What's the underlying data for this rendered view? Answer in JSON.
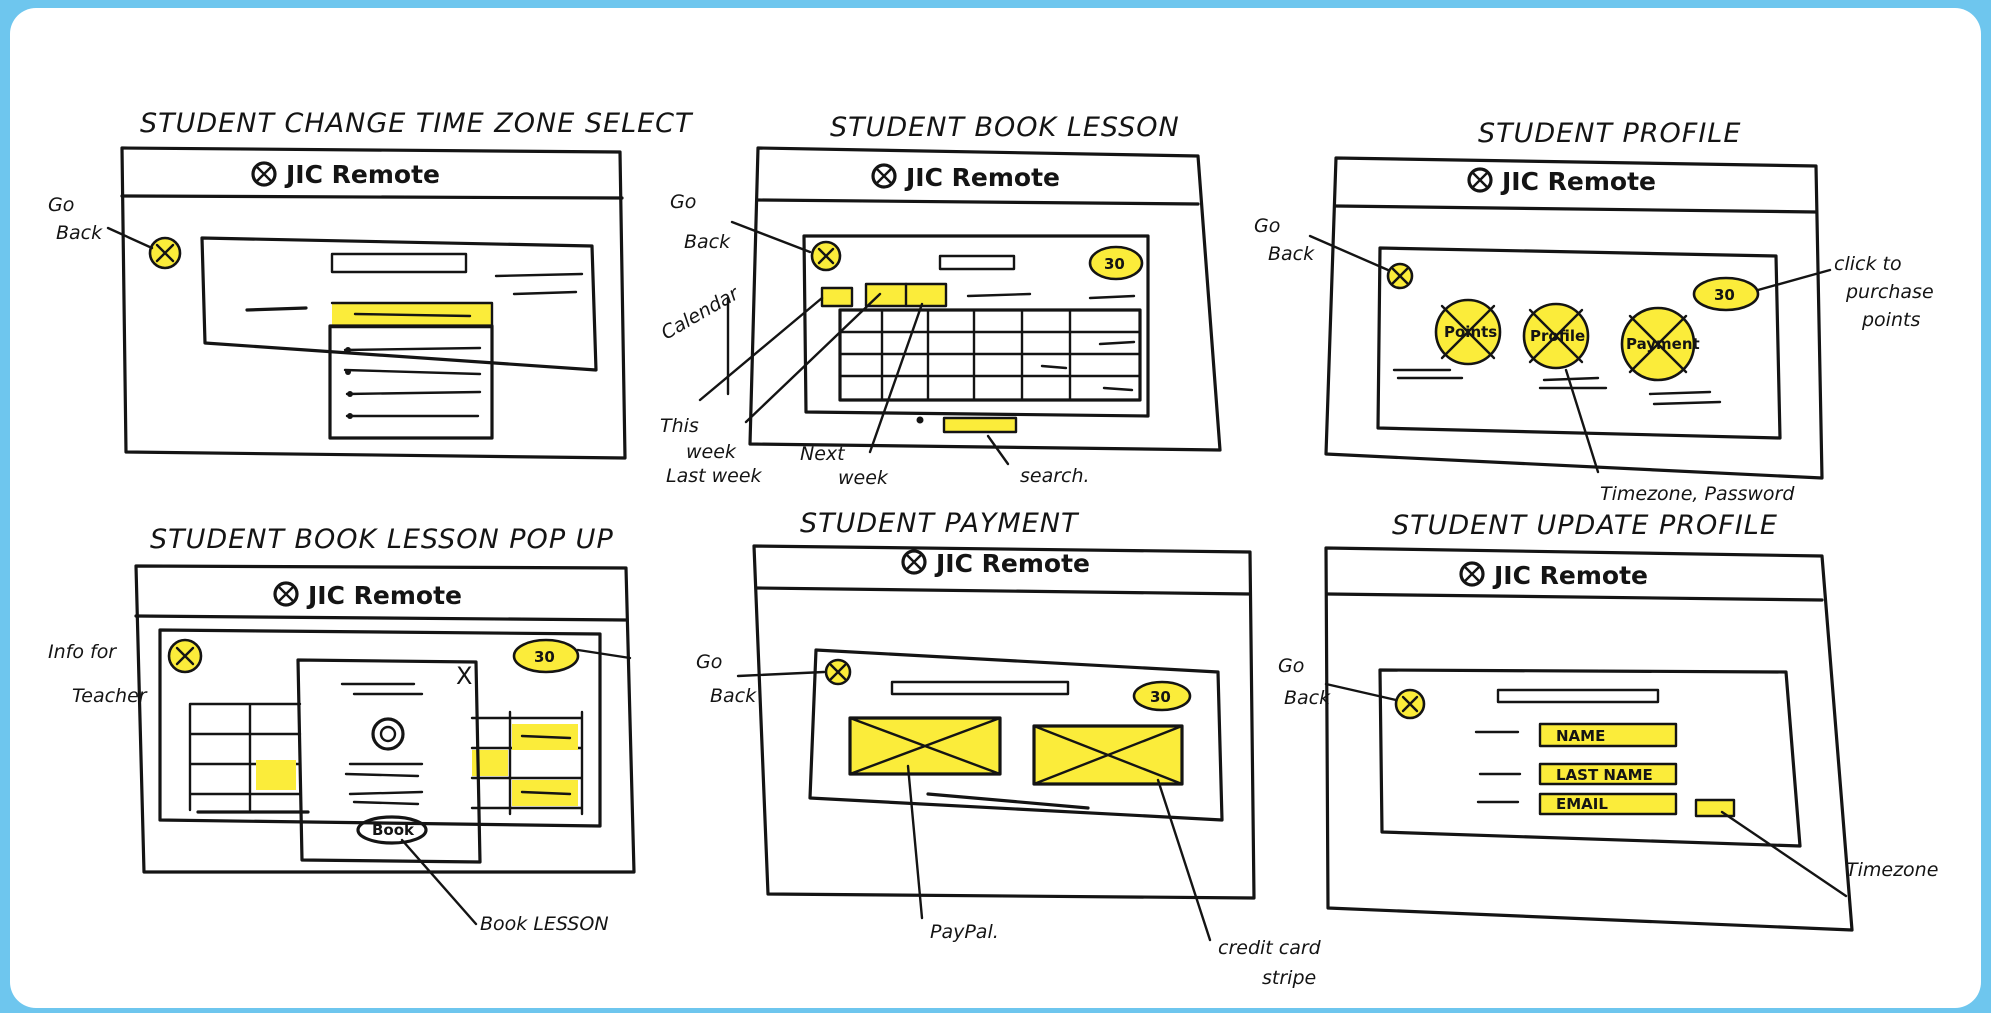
{
  "frames": [
    {
      "title": "STUDENT CHANGE TIME ZONE SELECT",
      "app_name": "JIC Remote",
      "notes": [
        "Go",
        "Back"
      ]
    },
    {
      "title": "STUDENT BOOK LESSON",
      "app_name": "JIC Remote",
      "points": "30",
      "notes": [
        "Go",
        "Back",
        "Calendar",
        "This",
        "week",
        "Last week",
        "Next",
        "week",
        "search."
      ]
    },
    {
      "title": "STUDENT PROFILE",
      "app_name": "JIC Remote",
      "points": "30",
      "avatars": [
        "Points",
        "Profile",
        "Payment"
      ],
      "notes": [
        "Go",
        "Back",
        "click to",
        "purchase",
        "points",
        "Timezone, Password"
      ]
    },
    {
      "title": "STUDENT BOOK LESSON POP UP",
      "app_name": "JIC Remote",
      "points": "30",
      "popup_close": "X",
      "popup_button": "Book",
      "notes": [
        "Info for",
        "Teacher",
        "Book LESSON"
      ]
    },
    {
      "title": "STUDENT PAYMENT",
      "app_name": "JIC Remote",
      "points": "30",
      "notes": [
        "Go",
        "Back",
        "PayPal.",
        "credit card",
        "stripe"
      ]
    },
    {
      "title": "STUDENT UPDATE PROFILE",
      "app_name": "JIC Remote",
      "fields": [
        "NAME",
        "LAST NAME",
        "EMAIL"
      ],
      "notes": [
        "Go",
        "Back",
        "Timezone"
      ]
    }
  ]
}
